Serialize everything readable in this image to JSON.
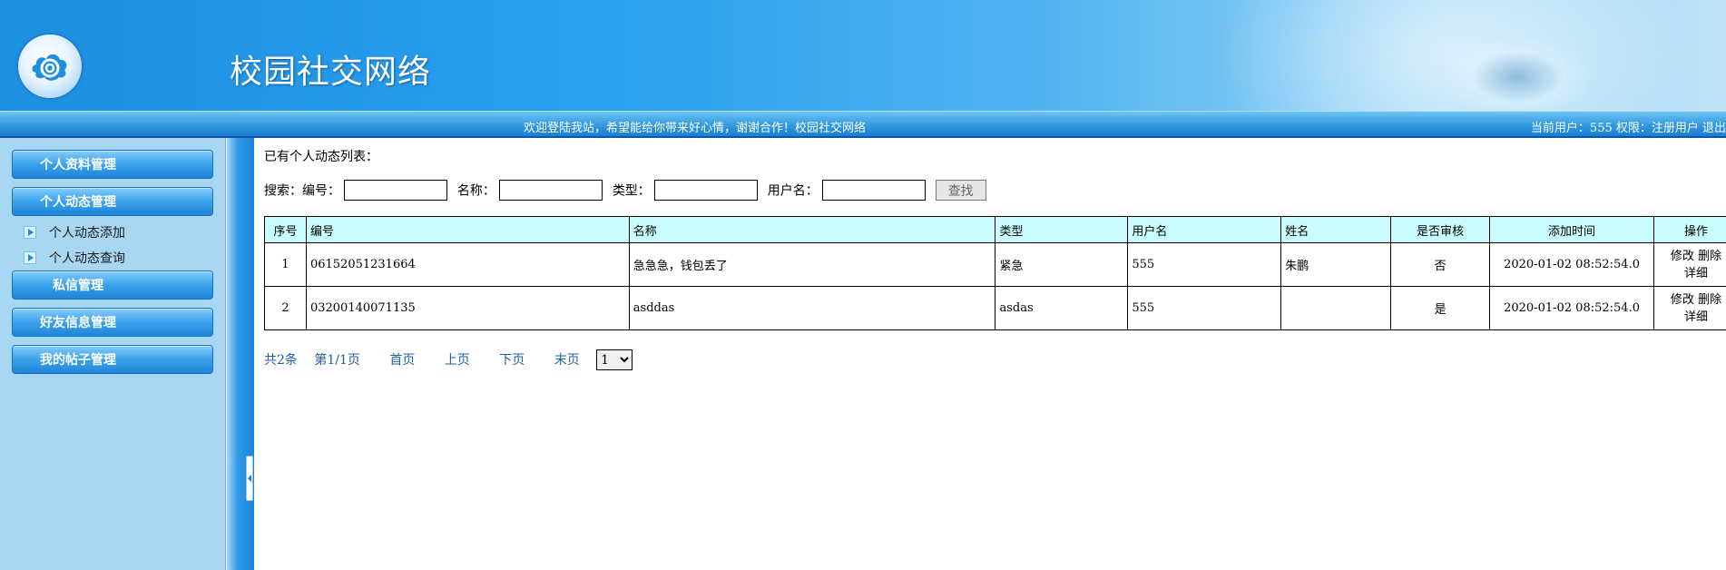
{
  "header": {
    "site_title": "校园社交网络",
    "logo_icon": "cloud-swirl-logo-icon"
  },
  "topbar": {
    "welcome": "欢迎登陆我站，希望能给你带来好心情，谢谢合作！校园社交网络",
    "user_info": "当前用户：555 权限：注册用户 退出"
  },
  "sidebar": {
    "menu": [
      {
        "label": "个人资料管理"
      },
      {
        "label": "个人动态管理"
      },
      {
        "label": "私信管理"
      },
      {
        "label": "好友信息管理"
      },
      {
        "label": "我的帖子管理"
      }
    ],
    "sub_items": [
      {
        "label": "个人动态添加"
      },
      {
        "label": "个人动态查询"
      }
    ]
  },
  "main": {
    "list_title": "已有个人动态列表：",
    "search": {
      "label_search": "搜索：",
      "label_code": "编号：",
      "label_name": "名称：",
      "label_type": "类型：",
      "label_user": "用户名：",
      "code_value": "",
      "name_value": "",
      "type_value": "",
      "user_value": "",
      "button": "查找"
    },
    "table": {
      "headers": [
        "序号",
        "编号",
        "名称",
        "类型",
        "用户名",
        "姓名",
        "是否审核",
        "添加时间",
        "操作"
      ],
      "rows": [
        {
          "index": "1",
          "code": "06152051231664",
          "name": "急急急，钱包丢了",
          "type": "紧急",
          "username": "555",
          "realname": "朱鹏",
          "audited": "否",
          "time": "2020-01-02 08:52:54.0",
          "edit": "修改",
          "delete": "删除",
          "detail": "详细"
        },
        {
          "index": "2",
          "code": "03200140071135",
          "name": "asddas",
          "type": "asdas",
          "username": "555",
          "realname": "",
          "audited": "是",
          "time": "2020-01-02 08:52:54.0",
          "edit": "修改",
          "delete": "删除",
          "detail": "详细"
        }
      ]
    },
    "pager": {
      "total": "共2条",
      "page": "第1/1页",
      "first": "首页",
      "prev": "上页",
      "next": "下页",
      "last": "末页",
      "select_value": "1"
    }
  },
  "colors": {
    "header_blue": "#2aa0ef",
    "table_header_bg": "#c9fdfd",
    "sidebar_bg": "#a8d7f3",
    "link_blue": "#1f5fa8"
  }
}
